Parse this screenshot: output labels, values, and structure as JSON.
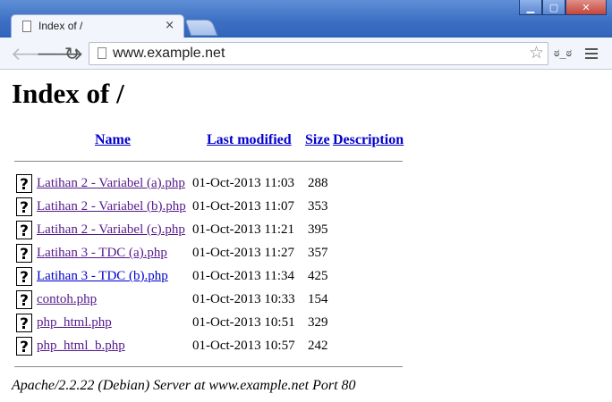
{
  "window": {
    "controls": [
      "minimize",
      "maximize",
      "close"
    ]
  },
  "tab": {
    "title": "Index of /"
  },
  "toolbar": {
    "url": "www.example.net",
    "extension_label": "ಠ_ಠ"
  },
  "page": {
    "heading": "Index of /",
    "columns": [
      "Name",
      "Last modified",
      "Size",
      "Description"
    ],
    "files": [
      {
        "name": "Latihan 2 - Variabel (a).php",
        "modified": "01-Oct-2013 11:03",
        "size": "288",
        "visited": true
      },
      {
        "name": "Latihan 2 - Variabel (b).php",
        "modified": "01-Oct-2013 11:07",
        "size": "353",
        "visited": true
      },
      {
        "name": "Latihan 2 - Variabel (c).php",
        "modified": "01-Oct-2013 11:21",
        "size": "395",
        "visited": true
      },
      {
        "name": "Latihan 3 - TDC (a).php",
        "modified": "01-Oct-2013 11:27",
        "size": "357",
        "visited": true
      },
      {
        "name": "Latihan 3 - TDC (b).php",
        "modified": "01-Oct-2013 11:34",
        "size": "425",
        "visited": false
      },
      {
        "name": "contoh.php",
        "modified": "01-Oct-2013 10:33",
        "size": "154",
        "visited": true
      },
      {
        "name": "php_html.php",
        "modified": "01-Oct-2013 10:51",
        "size": "329",
        "visited": true
      },
      {
        "name": "php_html_b.php",
        "modified": "01-Oct-2013 10:57",
        "size": "242",
        "visited": true
      }
    ],
    "footer": "Apache/2.2.22 (Debian) Server at www.example.net Port 80"
  },
  "colors": {
    "link": "#0000cc",
    "visited": "#551a8b",
    "titlebar": "#3c6fc3"
  }
}
